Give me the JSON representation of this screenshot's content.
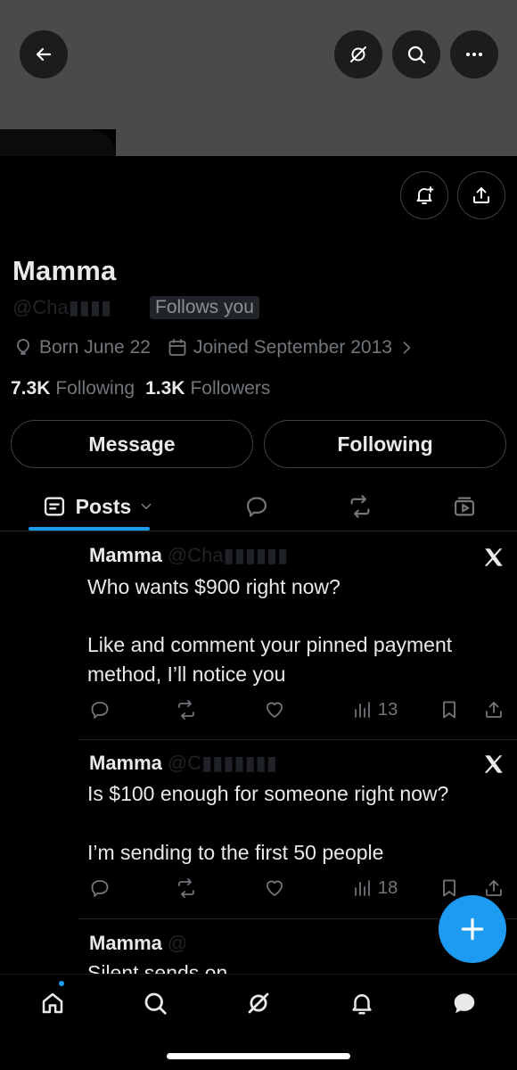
{
  "profile": {
    "name": "Mamma",
    "handle": "@Cha▮▮▮▮",
    "follows_badge": "Follows you",
    "birthday": "Born June 22",
    "joined": "Joined September 2013",
    "following_count": "7.3K",
    "following_label": "Following",
    "followers_count": "1.3K",
    "followers_label": "Followers"
  },
  "buttons": {
    "message": "Message",
    "following": "Following"
  },
  "tabs": {
    "active_label": "Posts"
  },
  "posts": [
    {
      "author": "Mamma",
      "handle": "@Cha▮▮▮▮▮▮",
      "line1": "Who wants $900 right now?",
      "line2": "Like and comment your pinned payment",
      "line3": "method, I’ll notice you",
      "views": "13"
    },
    {
      "author": "Mamma",
      "handle": "@C▮▮▮▮▮▮▮",
      "line1": "Is $100 enough for someone right now?",
      "line2": "I’m sending to the first 50 people",
      "views": "18"
    },
    {
      "author": "Mamma",
      "handle": "@",
      "line1": "Silent sends on"
    }
  ],
  "colors": {
    "accent": "#1d9bf0",
    "background": "#000000",
    "banner": "#4a4a4a",
    "muted_text": "#71767b",
    "border": "#3e4144"
  }
}
